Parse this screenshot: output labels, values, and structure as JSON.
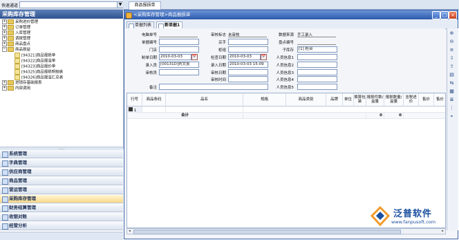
{
  "quick": {
    "label": "快速通道",
    "dropdown": "▼"
  },
  "left": {
    "title": "采购库存管理",
    "tree": [
      {
        "label": "采购进价管理",
        "kind": "folder",
        "exp": "+"
      },
      {
        "label": "订单管理",
        "kind": "folder",
        "exp": "+"
      },
      {
        "label": "入库管理",
        "kind": "folder",
        "exp": "+"
      },
      {
        "label": "调拨管理",
        "kind": "folder",
        "exp": "+"
      },
      {
        "label": "商品盘点",
        "kind": "folder",
        "exp": "+"
      },
      {
        "label": "商品损益",
        "kind": "folder",
        "exp": "−"
      },
      {
        "label": "[94321]商品报损单",
        "kind": "leaf"
      },
      {
        "label": "[94322]商品报溢单",
        "kind": "leaf"
      },
      {
        "label": "[94323]商品报价单",
        "kind": "leaf"
      },
      {
        "label": "[94325]商品报损明细表",
        "kind": "leaf"
      },
      {
        "label": "[94326]商品报溢汇总表",
        "kind": "leaf"
      },
      {
        "label": "进销存基础报表",
        "kind": "folder",
        "exp": "+"
      },
      {
        "label": "内部调用",
        "kind": "folder",
        "exp": "+"
      }
    ],
    "splitter": "......",
    "nav": [
      {
        "label": "系统管理",
        "active": false
      },
      {
        "label": "字典管理",
        "active": false
      },
      {
        "label": "供应商管理",
        "active": false
      },
      {
        "label": "商品管理",
        "active": false
      },
      {
        "label": "营运管理",
        "active": false
      },
      {
        "label": "采购库存管理",
        "active": true
      },
      {
        "label": "财务结算管理",
        "active": false
      },
      {
        "label": "收银对账",
        "active": false
      },
      {
        "label": "经营分析",
        "active": false
      }
    ]
  },
  "doc_tab": "商品报损单",
  "window": {
    "title": "<采购库存管理>商品报损单",
    "buttons": {
      "min": "_",
      "max": "□",
      "close": "×"
    }
  },
  "subtabs": [
    {
      "label": "单据列表"
    },
    {
      "label": "新单据1"
    }
  ],
  "form": {
    "doc_no": {
      "label": "电脑单号",
      "value": ""
    },
    "audit_flag": {
      "label": "审核标志",
      "value": "未审核"
    },
    "data_source": {
      "label": "数据来源",
      "value": "手工录入"
    },
    "bill_no": {
      "label": "单据编号",
      "value": ""
    },
    "buyer": {
      "label": "买手",
      "value": ""
    },
    "check_no": {
      "label": "盘点编号",
      "value": ""
    },
    "store": {
      "label": "门店",
      "value": ""
    },
    "group": {
      "label": "柜组",
      "value": ""
    },
    "sub_warehouse": {
      "label": "子库存",
      "value": "[1] 柜台"
    },
    "make_date": {
      "label": "制单日期",
      "value": "2010-03-03"
    },
    "check_date": {
      "label": "检查日期",
      "value": "2010-03-03"
    },
    "staff1": {
      "label": "人员信息1",
      "value": ""
    },
    "entry_person": {
      "label": "录入员",
      "value": "[00131D]刘文勇"
    },
    "entry_date": {
      "label": "录入日期",
      "value": "2010-03-03 15:09"
    },
    "staff2": {
      "label": "人员信息2",
      "value": ""
    },
    "auditor": {
      "label": "审核员",
      "value": ""
    },
    "audit_date": {
      "label": "审核日期",
      "value": ""
    },
    "staff3": {
      "label": "人员信息3",
      "value": ""
    },
    "audit_time": {
      "label": "审核时间",
      "value": ""
    },
    "staff4": {
      "label": "人员信息4",
      "value": ""
    },
    "remark": {
      "label": "备注",
      "value": ""
    },
    "staff5": {
      "label": "人员信息5",
      "value": ""
    },
    "cal_icon": "📅"
  },
  "grid": {
    "headers": [
      "行号",
      "商品条码",
      "品名",
      "规格",
      "商品类别",
      "品牌",
      "单位",
      "换算包装",
      "报损件数/盒量",
      "报损数量/盒量",
      "含税进价",
      "售价",
      "售价"
    ],
    "row": {
      "line": "1"
    },
    "total": {
      "label": "合计",
      "qty1": "0",
      "qty2": "0"
    }
  },
  "right_tools": [
    "⊕",
    "⊖",
    "≡",
    "⇩",
    "⇧",
    "▤",
    "⇆",
    "▦",
    "≣",
    "⋮",
    "⌖"
  ],
  "logo": {
    "text": "泛普软件",
    "url": "www.fanpusoft.com"
  },
  "colors": {
    "accent": "#2c5aac",
    "brand": "#1a4fa0"
  }
}
